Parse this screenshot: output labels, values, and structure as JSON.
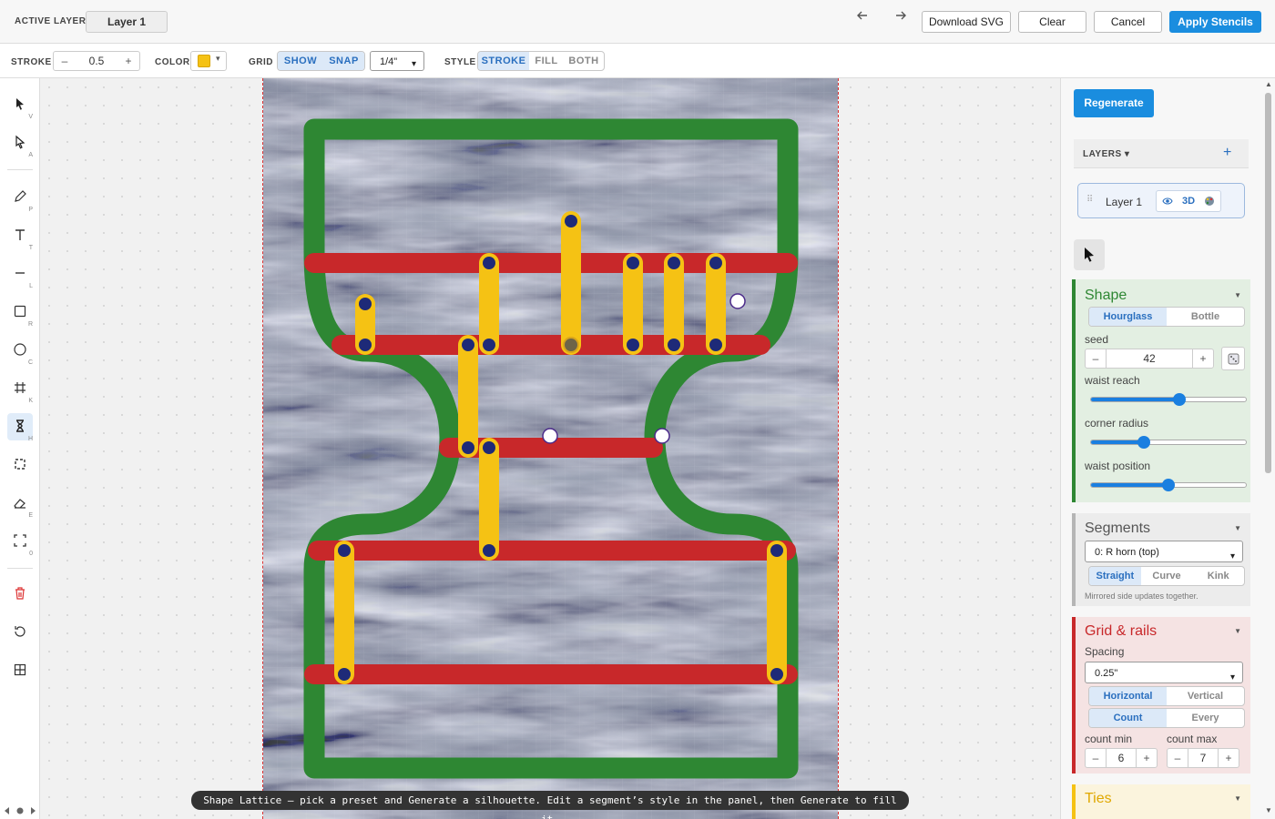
{
  "header": {
    "active_layer_label": "ACTIVE LAYER",
    "active_layer_value": "Layer 1",
    "undo_icon": "arrow-left-icon",
    "redo_icon": "arrow-right-icon",
    "download_label": "Download SVG",
    "clear_label": "Clear",
    "cancel_label": "Cancel",
    "apply_label": "Apply Stencils"
  },
  "toolbar": {
    "stroke_label": "STROKE",
    "stroke_minus": "–",
    "stroke_value": "0.5",
    "stroke_plus": "+",
    "color_label": "COLOR",
    "color_value": "#f5c214",
    "grid_label": "GRID",
    "grid_show": "SHOW",
    "grid_snap": "SNAP",
    "grid_spacing": "1/4\"",
    "style_label": "STYLE",
    "style_options": [
      "STROKE",
      "FILL",
      "BOTH"
    ],
    "style_selected": "STROKE"
  },
  "tools": [
    {
      "name": "select-tool",
      "key": "V"
    },
    {
      "name": "direct-select-tool",
      "key": "A"
    },
    {
      "name": "pen-tool",
      "key": "P"
    },
    {
      "name": "text-tool",
      "key": "T"
    },
    {
      "name": "line-tool",
      "key": "L"
    },
    {
      "name": "rect-tool",
      "key": "R"
    },
    {
      "name": "circle-tool",
      "key": "C"
    },
    {
      "name": "grid-tool",
      "key": "K"
    },
    {
      "name": "hourglass-tool",
      "key": "H"
    },
    {
      "name": "transform-tool",
      "key": ""
    },
    {
      "name": "eraser-tool",
      "key": "E"
    },
    {
      "name": "fit-tool",
      "key": "0"
    },
    {
      "name": "trash-tool",
      "key": ""
    },
    {
      "name": "reset-tool",
      "key": ""
    },
    {
      "name": "tile-tool",
      "key": ""
    }
  ],
  "status_text": "Shape Lattice — pick a preset and Generate a silhouette. Edit a segment’s style in the panel, then Generate to fill it.",
  "right_panel": {
    "regenerate_label": "Regenerate",
    "layers_label": "LAYERS ▾",
    "add_layer": "+",
    "layer_name": "Layer 1",
    "layer_3d": "3D",
    "shape": {
      "title": "Shape",
      "presets": [
        "Hourglass",
        "Bottle"
      ],
      "preset_selected": "Hourglass",
      "seed_label": "seed",
      "seed_minus": "–",
      "seed_value": "42",
      "seed_plus": "+",
      "waist_reach_label": "waist reach",
      "waist_reach": 0.57,
      "corner_radius_label": "corner radius",
      "corner_radius": 0.34,
      "waist_position_label": "waist position",
      "waist_position": 0.5
    },
    "segments": {
      "title": "Segments",
      "selected": "0: R horn (top)",
      "modes": [
        "Straight",
        "Curve",
        "Kink"
      ],
      "mode_selected": "Straight",
      "note": "Mirrored side updates together."
    },
    "grid_rails": {
      "title": "Grid & rails",
      "spacing_label": "Spacing",
      "spacing": "0.25\"",
      "orientations": [
        "Horizontal",
        "Vertical"
      ],
      "orientation_selected": "Horizontal",
      "methods": [
        "Count",
        "Every"
      ],
      "method_selected": "Count",
      "count_min_label": "count min",
      "count_min": "6",
      "count_max_label": "count max",
      "count_max": "7",
      "minus": "–",
      "plus": "+"
    },
    "ties": {
      "title": "Ties"
    }
  },
  "colors": {
    "outline": "#2e8733",
    "rail": "#c8282a",
    "tie": "#f5c214",
    "node": "#1e2a78",
    "accent": "#1a8ddf",
    "shape_panel": "#e3efe2",
    "grid_panel": "#f5e3e3",
    "ties_panel": "#fbf4dd"
  }
}
